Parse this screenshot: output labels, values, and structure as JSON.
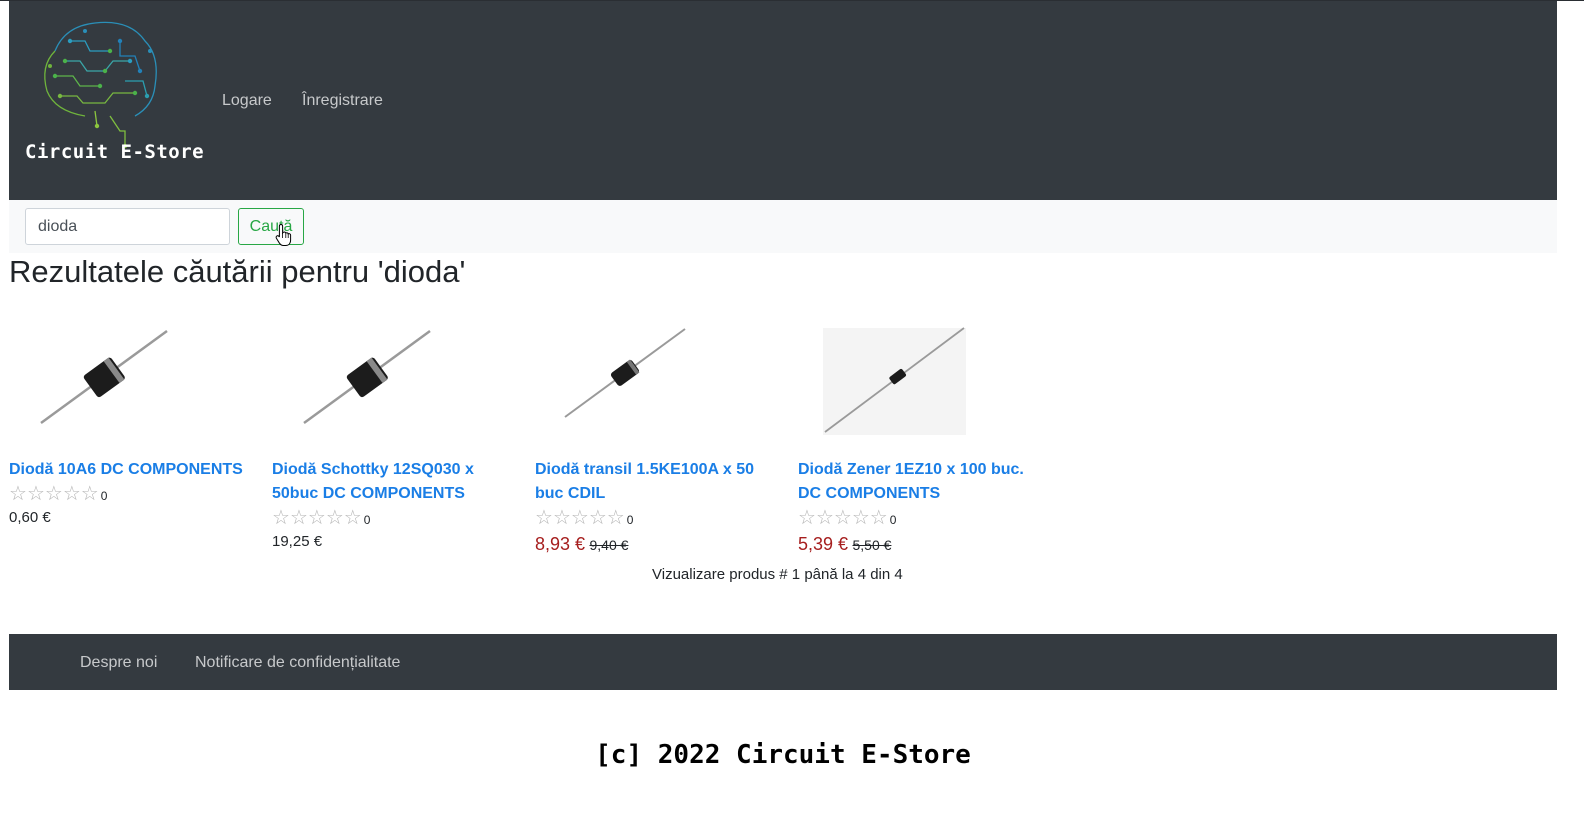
{
  "header": {
    "logo_text": "Circuit E-Store",
    "nav": [
      "Logare",
      "Înregistrare"
    ]
  },
  "search": {
    "value": "dioda",
    "button_label": "Caută"
  },
  "results": {
    "title": "Rezultatele căutării pentru 'dioda'",
    "products": [
      {
        "name": "Diodă 10A6 DC COMPONENTS",
        "rating_count": "0",
        "price": "0,60 €",
        "old_price": ""
      },
      {
        "name": "Diodă Schottky 12SQ030 x 50buc DC COMPONENTS",
        "rating_count": "0",
        "price": "19,25 €",
        "old_price": ""
      },
      {
        "name": "Diodă transil 1.5KE100A x 50 buc CDIL",
        "rating_count": "0",
        "price": "8,93 €",
        "old_price": "9,40 €"
      },
      {
        "name": "Diodă Zener 1EZ10 x 100 buc. DC COMPONENTS",
        "rating_count": "0",
        "price": "5,39 €",
        "old_price": "5,50 €"
      }
    ],
    "pagination_info": "Vizualizare produs # 1 până la 4 din 4"
  },
  "footer": {
    "links": [
      "Despre noi",
      "Notificare de confidențialitate"
    ],
    "copyright": "[c] 2022 Circuit E-Store"
  },
  "colors": {
    "header_bg": "#343a40",
    "link": "#1a7ee6",
    "sale_price": "#a61e1e",
    "search_button": "#28a745"
  }
}
